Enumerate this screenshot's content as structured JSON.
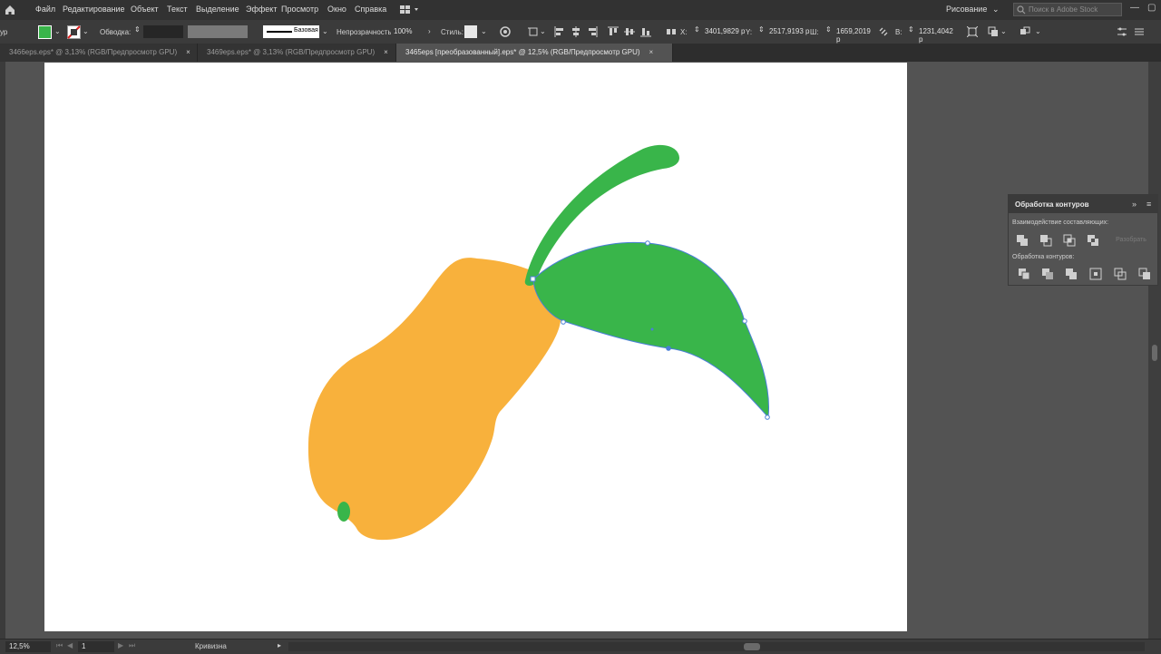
{
  "menubar": {
    "items": [
      "Файл",
      "Редактирование",
      "Объект",
      "Текст",
      "Выделение",
      "Эффект",
      "Просмотр",
      "Окно",
      "Справка"
    ],
    "workspace": "Рисование",
    "search_placeholder": "Поиск в Adobe Stock"
  },
  "control": {
    "left_cut": "ур",
    "stroke_label": "Обводка:",
    "stroke_style": "Базовая",
    "opacity_label": "Непрозрачность:",
    "opacity_value": "100%",
    "styles_label": "Стиль:",
    "x_label": "X:",
    "x_value": "3401,9829 р",
    "y_label": "Y:",
    "y_value": "2517,9193 р",
    "w_label": "Ш:",
    "w_value": "1659,2019 р",
    "h_label": "В:",
    "h_value": "1231,4042 р",
    "fill_color": "#39b54a"
  },
  "tabs": [
    {
      "label": "3466eps.eps* @ 3,13% (RGB/Предпросмотр GPU)",
      "active": false
    },
    {
      "label": "3469eps.eps* @ 3,13% (RGB/Предпросмотр GPU)",
      "active": false
    },
    {
      "label": "3465eps [преобразованный].eps* @ 12,5% (RGB/Предпросмотр GPU)",
      "active": true
    }
  ],
  "tab_close": "×",
  "panel": {
    "title": "Обработка контуров",
    "shape_modes_label": "Взаимодействие составляющих:",
    "pathfinders_label": "Обработка контуров:",
    "expand_label": "Разобрать"
  },
  "status": {
    "zoom": "12,5%",
    "artboard": "1",
    "tool": "Кривизна"
  },
  "artwork": {
    "pear_color": "#f8b13c",
    "leaf_color": "#39b54a",
    "selection_color": "#4a7fd6"
  }
}
